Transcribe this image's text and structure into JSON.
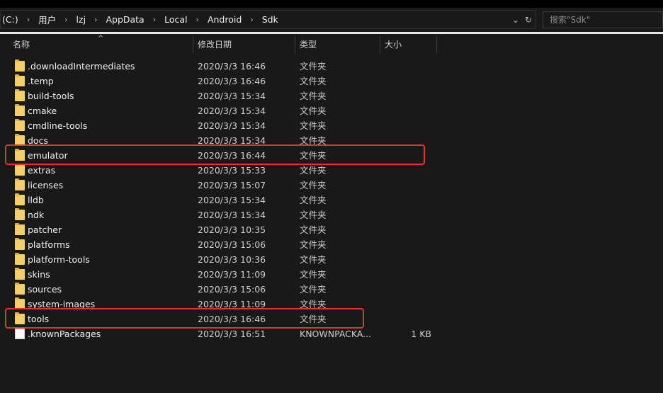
{
  "address_path": {
    "drive": "(C:)",
    "segments": [
      "用户",
      "lzj",
      "AppData",
      "Local",
      "Android",
      "Sdk"
    ]
  },
  "search": {
    "placeholder": "搜索\"Sdk\""
  },
  "columns": {
    "name": "名称",
    "date": "修改日期",
    "type": "类型",
    "size": "大小"
  },
  "files": [
    {
      "name": ".downloadIntermediates",
      "date": "2020/3/3 16:46",
      "type": "文件夹",
      "size": "",
      "kind": "folder"
    },
    {
      "name": ".temp",
      "date": "2020/3/3 16:46",
      "type": "文件夹",
      "size": "",
      "kind": "folder"
    },
    {
      "name": "build-tools",
      "date": "2020/3/3 15:34",
      "type": "文件夹",
      "size": "",
      "kind": "folder"
    },
    {
      "name": "cmake",
      "date": "2020/3/3 15:34",
      "type": "文件夹",
      "size": "",
      "kind": "folder"
    },
    {
      "name": "cmdline-tools",
      "date": "2020/3/3 15:34",
      "type": "文件夹",
      "size": "",
      "kind": "folder"
    },
    {
      "name": "docs",
      "date": "2020/3/3 15:34",
      "type": "文件夹",
      "size": "",
      "kind": "folder"
    },
    {
      "name": "emulator",
      "date": "2020/3/3 16:44",
      "type": "文件夹",
      "size": "",
      "kind": "folder",
      "highlighted": true
    },
    {
      "name": "extras",
      "date": "2020/3/3 15:33",
      "type": "文件夹",
      "size": "",
      "kind": "folder"
    },
    {
      "name": "licenses",
      "date": "2020/3/3 15:07",
      "type": "文件夹",
      "size": "",
      "kind": "folder"
    },
    {
      "name": "lldb",
      "date": "2020/3/3 15:34",
      "type": "文件夹",
      "size": "",
      "kind": "folder"
    },
    {
      "name": "ndk",
      "date": "2020/3/3 15:34",
      "type": "文件夹",
      "size": "",
      "kind": "folder"
    },
    {
      "name": "patcher",
      "date": "2020/3/3 10:35",
      "type": "文件夹",
      "size": "",
      "kind": "folder"
    },
    {
      "name": "platforms",
      "date": "2020/3/3 15:06",
      "type": "文件夹",
      "size": "",
      "kind": "folder"
    },
    {
      "name": "platform-tools",
      "date": "2020/3/3 10:36",
      "type": "文件夹",
      "size": "",
      "kind": "folder"
    },
    {
      "name": "skins",
      "date": "2020/3/3 11:09",
      "type": "文件夹",
      "size": "",
      "kind": "folder"
    },
    {
      "name": "sources",
      "date": "2020/3/3 15:06",
      "type": "文件夹",
      "size": "",
      "kind": "folder"
    },
    {
      "name": "system-images",
      "date": "2020/3/3 11:09",
      "type": "文件夹",
      "size": "",
      "kind": "folder"
    },
    {
      "name": "tools",
      "date": "2020/3/3 16:46",
      "type": "文件夹",
      "size": "",
      "kind": "folder",
      "highlighted": true
    },
    {
      "name": ".knownPackages",
      "date": "2020/3/3 16:51",
      "type": "KNOWNPACKA...",
      "size": "1 KB",
      "kind": "file"
    }
  ],
  "colors": {
    "background": "#191919",
    "highlight": "#e23232",
    "folder": "#f3cf68"
  }
}
